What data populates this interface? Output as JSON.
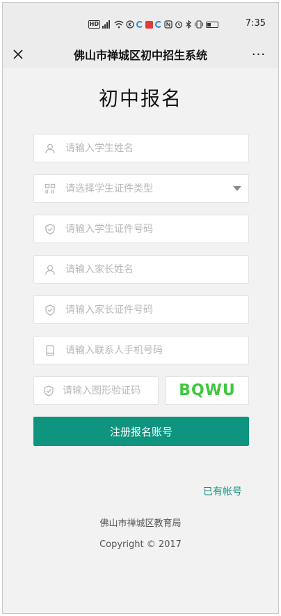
{
  "status_bar": {
    "hd_label": "HD",
    "time": "7:35"
  },
  "nav": {
    "title": "佛山市禅城区初中招生系统",
    "more_label": "···"
  },
  "page": {
    "title": "初中报名"
  },
  "form": {
    "student_name_placeholder": "请输入学生姓名",
    "student_id_type_placeholder": "请选择学生证件类型",
    "student_id_number_placeholder": "请输入学生证件号码",
    "parent_name_placeholder": "请输入家长姓名",
    "parent_id_number_placeholder": "请输入家长证件号码",
    "contact_phone_placeholder": "请输入联系人手机号码",
    "captcha_placeholder": "请输入图形验证码",
    "captcha_text": "BQWU",
    "submit_label": "注册报名账号"
  },
  "links": {
    "have_account": "已有帐号"
  },
  "footer": {
    "org": "佛山市禅城区教育局",
    "copyright": "Copyright © 2017"
  },
  "colors": {
    "accent": "#0f9480",
    "captcha": "#3fc83f",
    "background": "#f2f2f2"
  },
  "icons": {
    "person": "person-icon",
    "grid": "grid-icon",
    "shield": "shield-check-icon",
    "phone": "phone-icon"
  }
}
